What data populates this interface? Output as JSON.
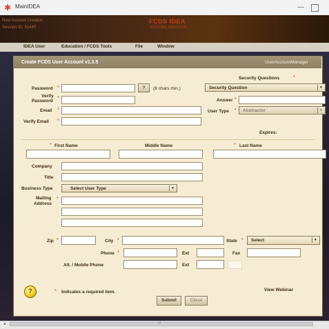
{
  "window": {
    "title": "MainIDEA"
  },
  "header": {
    "left_line1": "New Account Creation",
    "left_line2": "Session ID: 91440",
    "brand": "FCDS IDEA",
    "brand_sub": "FCDSWQ 09/02/2025"
  },
  "menu": [
    "IDEA User",
    "Education / FCDS Tools",
    "File",
    "Window"
  ],
  "dialog": {
    "title": "Create FCDS User Account  v1.3.5",
    "context": "UserAccountManager",
    "password_label": "Password",
    "password_hint_button": "?",
    "password_hint": "(8 chars min.)",
    "verify_password_label_1": "Verify",
    "verify_password_label_2": "Password",
    "email_label": "Email",
    "verify_email_label": "Verify Email",
    "security_heading": "Security Questions",
    "security_question": "Security Question",
    "answer_label": "Answer",
    "user_type_label": "User Type",
    "user_type_value": "Abstractor",
    "expires_label": "Expires:",
    "first_name_label": "First Name",
    "middle_name_label": "Middle Name",
    "last_name_label": "Last Name",
    "company_label": "Company",
    "title_label": "Title",
    "business_type_label": "Business Type",
    "business_type_value": "Select User Type",
    "mailing_label_1": "Mailing",
    "mailing_label_2": "Address",
    "zip_label": "Zip",
    "city_label": "City",
    "state_label": "State",
    "state_value": "Select",
    "phone_label": "Phone",
    "ext_label": "Ext",
    "fax_label": "Fax",
    "alt_phone_label": "Alt. / Mobile Phone",
    "ext2_label": "Ext",
    "required_note": "Indicates a required item.",
    "webinar_link": "View Webinar",
    "submit_label": "Submit",
    "close_label": "Close",
    "asterisk": "*"
  },
  "scrollbar": {
    "grip": "III"
  }
}
